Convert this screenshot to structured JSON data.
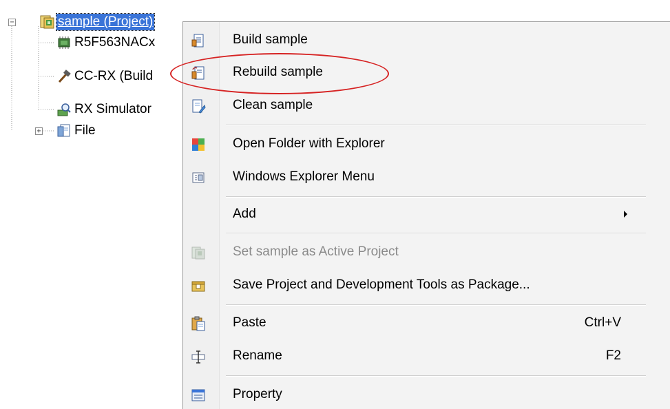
{
  "tree": {
    "root": {
      "label": "sample (Project)",
      "expander": "−",
      "icon": "project-icon"
    },
    "children": [
      {
        "label": "R5F563NACx",
        "icon": "microcontroller-chip-icon"
      },
      {
        "label": "CC-RX (Build",
        "icon": "hammer-build-tool-icon"
      },
      {
        "label": "RX Simulator",
        "icon": "debug-tool-simulator-icon"
      },
      {
        "label": "File",
        "icon": "file-node-icon",
        "expander": "+"
      }
    ]
  },
  "menu": {
    "items": [
      {
        "label": "Build sample",
        "icon": "build-icon",
        "enabled": true
      },
      {
        "label": "Rebuild sample",
        "icon": "rebuild-icon",
        "enabled": true
      },
      {
        "label": "Clean sample",
        "icon": "clean-icon",
        "enabled": true
      },
      {
        "label": "Open Folder with Explorer",
        "icon": "open-folder-explorer-icon",
        "enabled": true
      },
      {
        "label": "Windows Explorer Menu",
        "icon": "explorer-menu-icon",
        "enabled": true
      },
      {
        "label": "Add",
        "icon": "",
        "enabled": true,
        "submenu": true
      },
      {
        "label": "Set sample as Active Project",
        "icon": "active-project-icon",
        "enabled": false
      },
      {
        "label": "Save Project and Development Tools as Package...",
        "icon": "package-icon",
        "enabled": true
      },
      {
        "label": "Paste",
        "icon": "paste-icon",
        "shortcut": "Ctrl+V",
        "enabled": true
      },
      {
        "label": "Rename",
        "icon": "rename-icon",
        "shortcut": "F2",
        "enabled": true
      },
      {
        "label": "Property",
        "icon": "property-icon",
        "enabled": true
      }
    ]
  },
  "colors": {
    "selection": "#3a74d8",
    "highlight_ellipse": "#d62323",
    "menu_background": "#f3f3f3",
    "disabled_text": "#8a8a8a"
  }
}
